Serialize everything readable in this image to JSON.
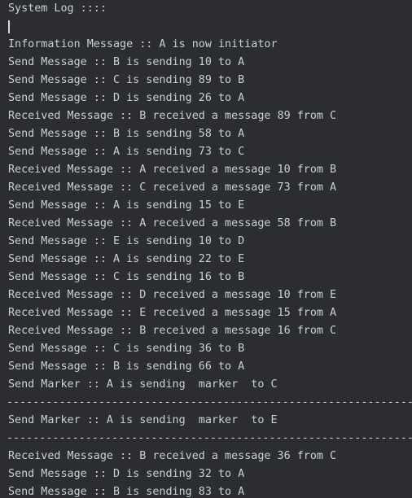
{
  "log": {
    "title": "System Log ::::",
    "entries": [
      "Information Message :: A is now initiator",
      "Send Message :: B is sending 10 to A",
      "Send Message :: C is sending 89 to B",
      "Send Message :: D is sending 26 to A",
      "Received Message :: B received a message 89 from C",
      "Send Message :: B is sending 58 to A",
      "Send Message :: A is sending 73 to C",
      "Received Message :: A received a message 10 from B",
      "Received Message :: C received a message 73 from A",
      "Send Message :: A is sending 15 to E",
      "Received Message :: A received a message 58 from B",
      "Send Message :: E is sending 10 to D",
      "Send Message :: A is sending 22 to E",
      "Send Message :: C is sending 16 to B",
      "Received Message :: D received a message 10 from E",
      "Received Message :: E received a message 15 from A",
      "Received Message :: B received a message 16 from C",
      "Send Message :: C is sending 36 to B",
      "Send Message :: B is sending 66 to A",
      "Send Marker :: A is sending  marker  to C",
      "--------------------------------------------------------------",
      "Send Marker :: A is sending  marker  to E",
      "--------------------------------------------------------------",
      "Received Message :: B received a message 36 from C",
      "Send Message :: D is sending 32 to A",
      "Send Message :: B is sending 83 to A"
    ]
  },
  "colors": {
    "background": "#2b2d30",
    "text": "#cbd0d6"
  }
}
